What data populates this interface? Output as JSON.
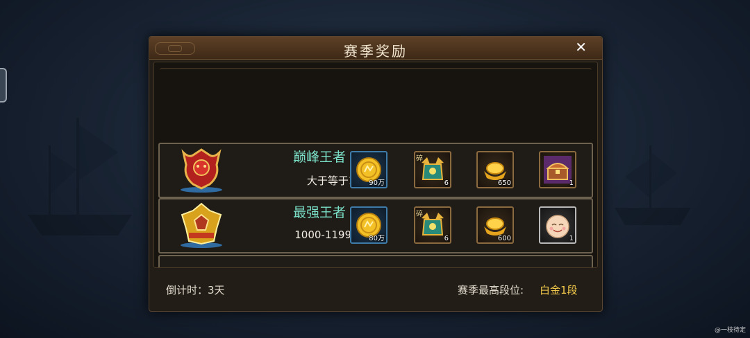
{
  "dialog": {
    "title": "赛季奖励",
    "close_label": "✕"
  },
  "ranks": [
    {
      "name": "巅峰王者",
      "range": "大于等于1200",
      "emblem_icon": "red-king-emblem-icon",
      "rewards": [
        {
          "icon": "gold-coin-icon",
          "count": "90万"
        },
        {
          "icon": "hero-shard-chest-icon",
          "count": "6",
          "tag": "碎"
        },
        {
          "icon": "gold-ingot-icon",
          "count": "650"
        },
        {
          "icon": "treasure-chest-icon",
          "count": "1"
        }
      ]
    },
    {
      "name": "最强王者",
      "range": "1000-1199",
      "emblem_icon": "gold-king-emblem-icon",
      "rewards": [
        {
          "icon": "gold-coin-icon",
          "count": "80万"
        },
        {
          "icon": "hero-shard-chest-icon",
          "count": "6",
          "tag": "碎"
        },
        {
          "icon": "gold-ingot-icon",
          "count": "600"
        },
        {
          "icon": "smiling-face-icon",
          "count": "1"
        }
      ]
    }
  ],
  "footer": {
    "countdown": "倒计时：3天",
    "season_best_label": "赛季最高段位:",
    "season_best_value": "白金1段"
  },
  "watermark": "@一枝待定",
  "colors": {
    "rank_name": "#7be0c8",
    "season_value": "#f2c84b",
    "title_bar": "#5e4026"
  }
}
